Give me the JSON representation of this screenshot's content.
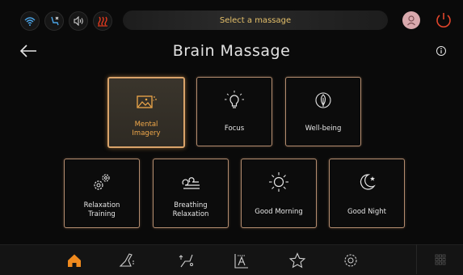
{
  "header": {
    "status_message": "Select a massage",
    "status_icons": [
      "wifi-icon",
      "recline-icon",
      "volume-icon",
      "heat-icon"
    ],
    "accent": "#e5c06a"
  },
  "page": {
    "title": "Brain Massage"
  },
  "programs": [
    {
      "label_lines": [
        "Mental",
        "Imagery"
      ],
      "icon": "image-icon",
      "selected": true
    },
    {
      "label_lines": [
        "Focus"
      ],
      "icon": "lightbulb-icon",
      "selected": false
    },
    {
      "label_lines": [
        "Well-being"
      ],
      "icon": "leaf-icon",
      "selected": false
    },
    {
      "label_lines": [
        "Relaxation",
        "Training"
      ],
      "icon": "gears-icon",
      "selected": false
    },
    {
      "label_lines": [
        "Breathing",
        "Relaxation"
      ],
      "icon": "breath-icon",
      "selected": false
    },
    {
      "label_lines": [
        "Good Morning"
      ],
      "icon": "sun-icon",
      "selected": false
    },
    {
      "label_lines": [
        "Good Night"
      ],
      "icon": "moon-icon",
      "selected": false
    }
  ],
  "bottom_nav": [
    "home-icon",
    "recline-chair-icon",
    "body-stretch-icon",
    "manual-massage-icon",
    "favorites-icon",
    "settings-icon",
    "apps-grid-icon"
  ],
  "colors": {
    "selected_border": "#d9a36a",
    "selected_label": "#f0a84a",
    "tile_border": "#b48d70",
    "heat_icon": "#e23a1e",
    "power_icon": "#e0452b",
    "home_icon": "#f08a1e"
  }
}
